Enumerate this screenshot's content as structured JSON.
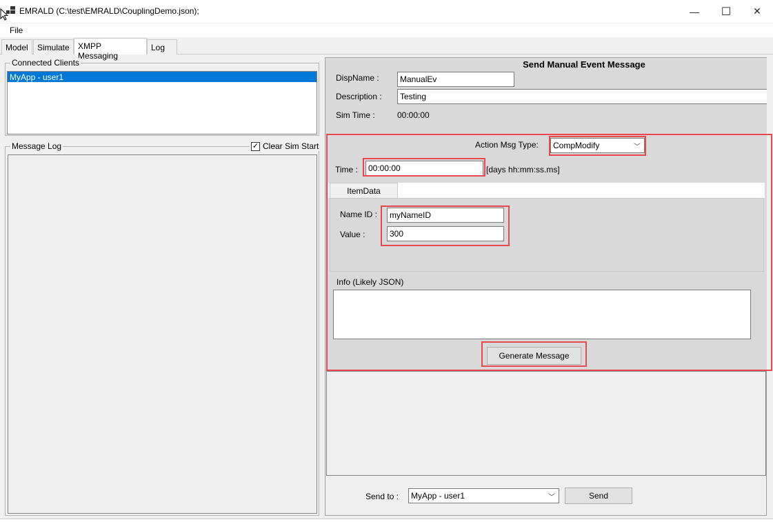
{
  "window": {
    "title": "EMRALD (C:\\test\\EMRALD\\CouplingDemo.json);",
    "minimize": "—",
    "maximize": "☐",
    "close": "✕"
  },
  "menu": {
    "file": "File"
  },
  "tabs": [
    {
      "label": "Model",
      "active": false
    },
    {
      "label": "Simulate",
      "active": false
    },
    {
      "label": "XMPP Messaging",
      "active": true
    },
    {
      "label": "Log",
      "active": false
    }
  ],
  "left": {
    "clients_title": "Connected Clients",
    "clients": [
      "MyApp - user1"
    ],
    "log_title": "Message Log",
    "clear_sim_start_label": "Clear Sim Start",
    "clear_sim_start_checked": true
  },
  "manual": {
    "heading": "Send Manual Event Message",
    "dispname_label": "DispName :",
    "dispname_value": "ManualEv",
    "description_label": "Description :",
    "description_value": "Testing",
    "simtime_label": "Sim Time :",
    "simtime_value": "00:00:00",
    "action_label": "Action Msg Type:",
    "action_value": "CompModify",
    "time_label": "Time :",
    "time_value": "00:00:00",
    "time_hint": "[days hh:mm:ss.ms]",
    "itemdata_tab": "ItemData",
    "nameid_label": "Name ID :",
    "nameid_value": "myNameID",
    "value_label": "Value :",
    "value_value": "300",
    "info_label": "Info (Likely JSON)",
    "info_value": "",
    "generate_label": "Generate Message"
  },
  "send": {
    "label": "Send to :",
    "target": "MyApp - user1",
    "button": "Send"
  },
  "colors": {
    "highlight_box": "#e8474b",
    "selection": "#0078d7",
    "panel_grey": "#d9d9d9"
  }
}
